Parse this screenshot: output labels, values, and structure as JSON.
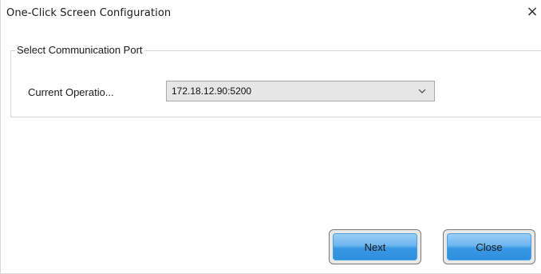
{
  "window": {
    "title": "One-Click Screen Configuration",
    "close_glyph": "×"
  },
  "port_group": {
    "legend": "Select Communication Port",
    "field_label": "Current Operatio...",
    "selected_value": "172.18.12.90:5200",
    "chevron_icon": "chevron-down-icon"
  },
  "buttons": {
    "next": "Next",
    "close": "Close"
  },
  "colors": {
    "button_blue": "#3a97e3",
    "select_bg": "#e6e6e6"
  }
}
